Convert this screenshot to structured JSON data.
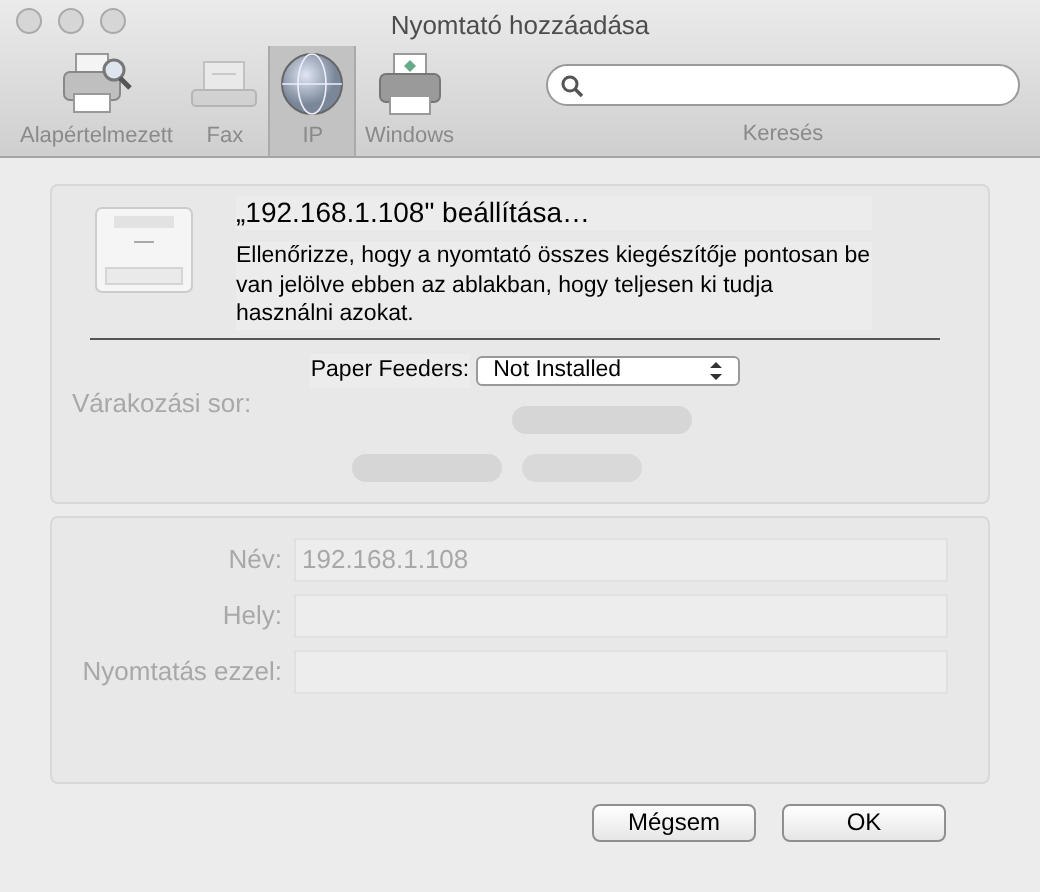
{
  "window": {
    "title": "Nyomtató hozzáadása"
  },
  "toolbar": {
    "items": [
      {
        "label": "Alapértelmezett",
        "kind": "default",
        "selected": false
      },
      {
        "label": "Fax",
        "kind": "fax",
        "selected": false
      },
      {
        "label": "IP",
        "kind": "ip",
        "selected": true
      },
      {
        "label": "Windows",
        "kind": "windows",
        "selected": false
      }
    ],
    "search": {
      "label": "Keresés"
    }
  },
  "background_form": {
    "queue_label": "Várakozási sor:",
    "name_label": "Név:",
    "name_value": "192.168.1.108",
    "location_label": "Hely:",
    "driver_label": "Nyomtatás ezzel:"
  },
  "sheet": {
    "title": "„192.168.1.108\" beállítása…",
    "message": "Ellenőrizze, hogy a nyomtató összes kiegészítője pontosan be van jelölve ebben az ablakban, hogy teljesen ki tudja használni azokat.",
    "options": [
      {
        "label": "Paper Feeders:",
        "value": "Not Installed"
      }
    ],
    "buttons": [
      {
        "label": "Mégsem"
      },
      {
        "label": "OK"
      }
    ]
  }
}
